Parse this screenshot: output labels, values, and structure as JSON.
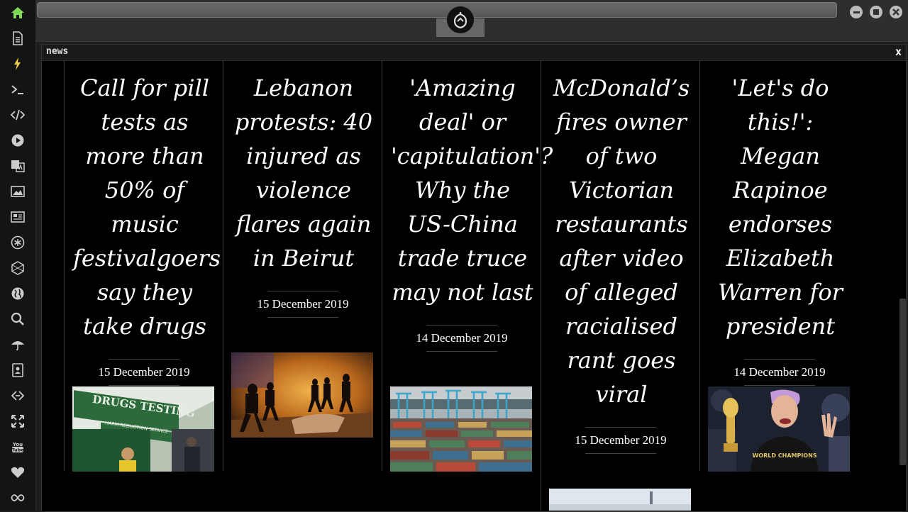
{
  "window": {
    "panel_title": "news",
    "close_label": "x"
  },
  "sidebar": {
    "icons": [
      "home-icon",
      "document-icon",
      "bolt-icon",
      "terminal-icon",
      "code-icon",
      "play-icon",
      "translate-icon",
      "image-icon",
      "newspaper-icon",
      "asterisk-icon",
      "hexagon-icon",
      "globe-icon",
      "search-icon",
      "umbrella-icon",
      "contacts-icon",
      "link-icon",
      "expand-icon",
      "youtube-icon",
      "heart-icon",
      "infinity-icon"
    ],
    "accent": "#7ed957",
    "bolt_color": "#f0d048"
  },
  "articles": [
    {
      "title": "Call for pill tests as more than 50% of music festivalgoers say they take drugs",
      "date": "15 December 2019"
    },
    {
      "title": "Lebanon protests: 40 injured as violence flares again in Beirut",
      "date": "15 December 2019"
    },
    {
      "title": "'Amazing deal' or 'capitulation'? Why the US-China trade truce may not last",
      "date": "14 December 2019"
    },
    {
      "title": "McDonald’s fires owner of two Victorian restaurants after video of alleged racialised rant goes viral",
      "date": "15 December 2019"
    },
    {
      "title": "'Let's do this!': Megan Rapinoe endorses Elizabeth Warren for president",
      "date": "14 December 2019"
    }
  ],
  "images": {
    "drugs_sign": "DRUGS TESTING",
    "drugs_subsign": "HARM REDUCTION SERVICE",
    "shirt_text": "WORLD CHAMPIONS"
  }
}
